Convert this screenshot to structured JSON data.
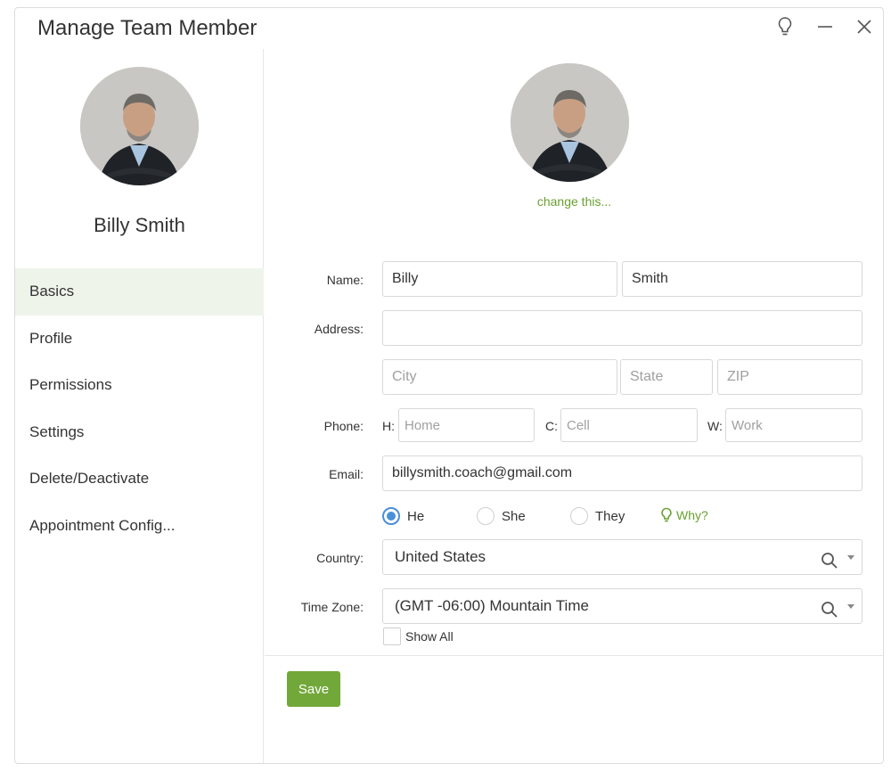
{
  "window": {
    "title": "Manage Team Member",
    "controls": [
      "lightbulb-icon",
      "minimize-icon",
      "close-icon"
    ]
  },
  "sidebar": {
    "member_name": "Billy Smith",
    "items": [
      {
        "label": "Basics",
        "active": true
      },
      {
        "label": "Profile",
        "active": false
      },
      {
        "label": "Permissions",
        "active": false
      },
      {
        "label": "Settings",
        "active": false
      },
      {
        "label": "Delete/Deactivate",
        "active": false
      },
      {
        "label": "Appointment Config...",
        "active": false
      }
    ]
  },
  "main": {
    "change_photo_label": "change this...",
    "form": {
      "name_label": "Name:",
      "first_name": "Billy",
      "last_name": "Smith",
      "address_label": "Address:",
      "address_value": "",
      "city_placeholder": "City",
      "state_placeholder": "State",
      "zip_placeholder": "ZIP",
      "phone_label": "Phone:",
      "phone_home_prefix": "H:",
      "phone_home_placeholder": "Home",
      "phone_cell_prefix": "C:",
      "phone_cell_placeholder": "Cell",
      "phone_work_prefix": "W:",
      "phone_work_placeholder": "Work",
      "email_label": "Email:",
      "email_value": "billysmith.coach@gmail.com",
      "pronouns": [
        {
          "label": "He",
          "selected": true
        },
        {
          "label": "She",
          "selected": false
        },
        {
          "label": "They",
          "selected": false
        }
      ],
      "why_label": "Why?",
      "country_label": "Country:",
      "country_value": "United States",
      "timezone_label": "Time Zone:",
      "timezone_value": "(GMT -06:00) Mountain Time",
      "show_all_label": "Show All",
      "show_all_checked": false
    },
    "save_label": "Save"
  },
  "colors": {
    "accent_green": "#72a83a",
    "link_green": "#6aa030",
    "active_nav_bg": "#eef4ea",
    "radio_blue": "#4a90d9"
  }
}
